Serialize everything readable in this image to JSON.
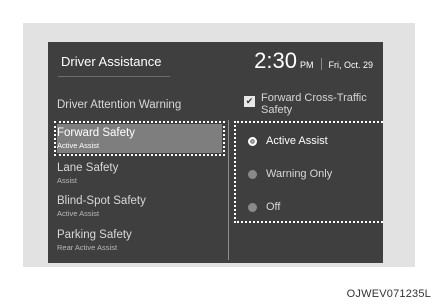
{
  "header": {
    "title": "Driver Assistance",
    "time": "2:30",
    "ampm": "PM",
    "date": "Fri, Oct. 29"
  },
  "menu": [
    {
      "label": "Driver Attention Warning",
      "sub": ""
    },
    {
      "label": "Forward Safety",
      "sub": "Active Assist",
      "selected": true
    },
    {
      "label": "Lane Safety",
      "sub": "Assist"
    },
    {
      "label": "Blind-Spot Safety",
      "sub": "Active Assist"
    },
    {
      "label": "Parking Safety",
      "sub": "Rear Active Assist"
    }
  ],
  "panel": {
    "checkbox_label": "Forward Cross-Traffic Safety",
    "checkbox_checked": true,
    "options": [
      {
        "label": "Active Assist",
        "selected": true
      },
      {
        "label": "Warning Only",
        "selected": false
      },
      {
        "label": "Off",
        "selected": false
      }
    ]
  },
  "caption": "OJWEV071235L"
}
